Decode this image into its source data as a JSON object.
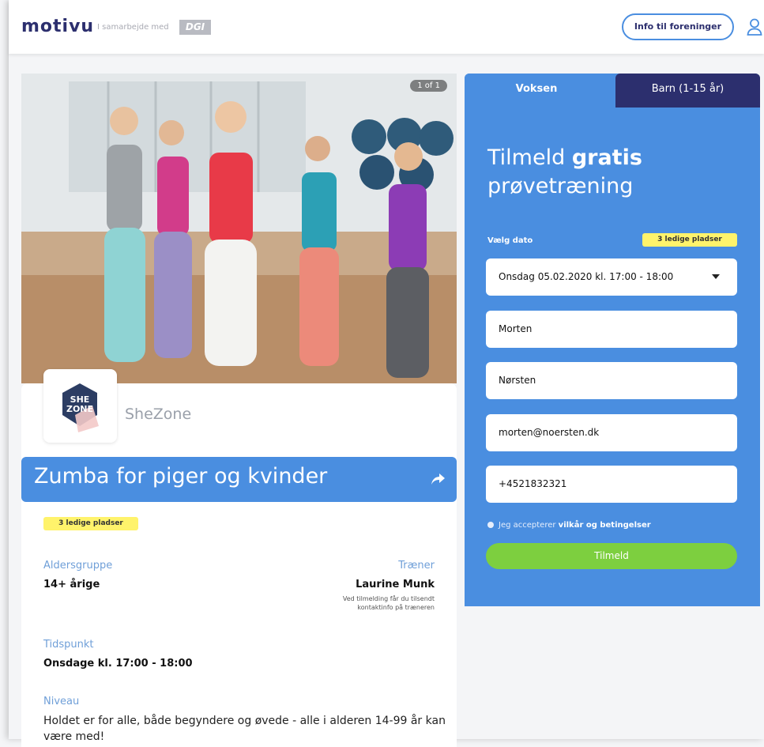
{
  "header": {
    "logo": "motivu",
    "partner_text": "I samarbejde med",
    "partner_badge": "DGI",
    "info_button": "Info til foreninger"
  },
  "gallery": {
    "counter": "1 of 1"
  },
  "club": {
    "name": "SheZone",
    "logo_text_top": "SHE",
    "logo_text_bottom": "ZONE"
  },
  "event": {
    "title": "Zumba for piger og kvinder",
    "spots": "3 ledige pladser",
    "age_label": "Aldersgruppe",
    "age_value": "14+ årige",
    "trainer_label": "Træner",
    "trainer_value": "Laurine Munk",
    "trainer_note_1": "Ved tilmelding får du tilsendt",
    "trainer_note_2": "kontaktinfo på træneren",
    "time_label": "Tidspunkt",
    "time_value": "Onsdage kl. 17:00 - 18:00",
    "level_label": "Niveau",
    "level_text_1": "Holdet er for alle, både begyndere og øvede - alle i alderen 14-99 år kan",
    "level_text_2": "være med!"
  },
  "signup": {
    "tab_adult": "Voksen",
    "tab_child": "Barn (1-15 år)",
    "title_prefix": "Tilmeld",
    "title_bold": "gratis",
    "title_line2": "prøvetræning",
    "date_label": "Vælg dato",
    "spots": "3 ledige pladser",
    "date_value": "Onsdag 05.02.2020 kl. 17:00 - 18:00",
    "first_name": "Morten",
    "last_name": "Nørsten",
    "email": "morten@noersten.dk",
    "phone": "+4521832321",
    "accept_prefix": "Jeg accepterer",
    "accept_link": "vilkår og betingelser",
    "submit": "Tilmeld"
  },
  "colors": {
    "primary": "#4a8ee0",
    "navy": "#2c2f6e",
    "green": "#7dcf3f",
    "badge": "#fff36b"
  }
}
